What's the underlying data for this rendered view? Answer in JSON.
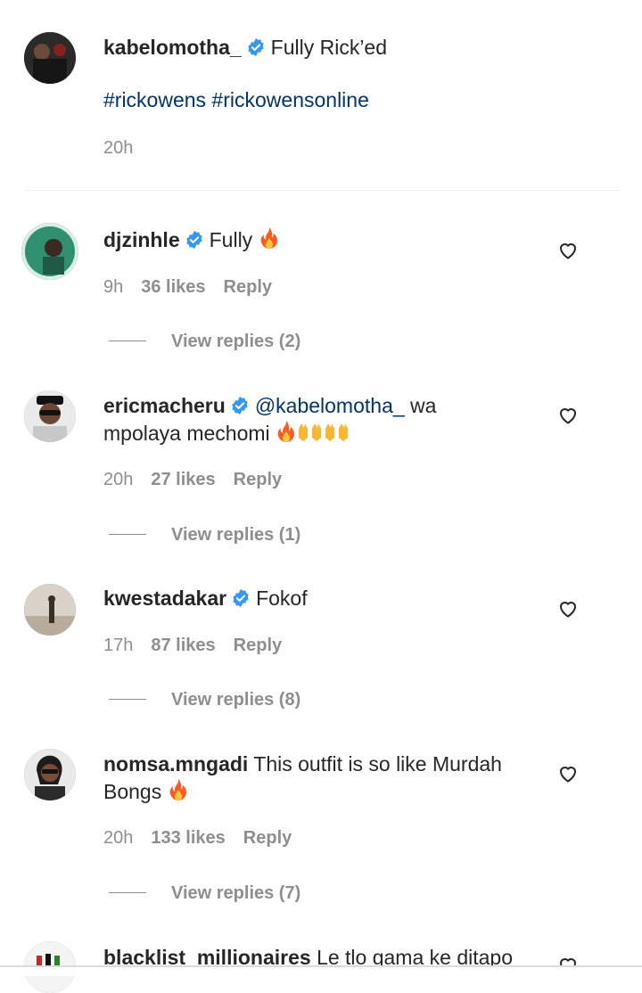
{
  "caption": {
    "username": "kabelomotha_",
    "text": "Fully Rick’ed",
    "hashtags": "#rickowens #rickowensonline",
    "time": "20h"
  },
  "comments": [
    {
      "username": "djzinhle",
      "mention": "",
      "text": "Fully",
      "text2": "",
      "time": "9h",
      "likes": "36 likes",
      "reply": "Reply",
      "view_replies": "View replies (2)"
    },
    {
      "username": "ericmacheru",
      "mention": "@kabelomotha_",
      "text": "wa",
      "text2": "mpolaya mechomi",
      "time": "20h",
      "likes": "27 likes",
      "reply": "Reply",
      "view_replies": "View replies (1)"
    },
    {
      "username": "kwestadakar",
      "mention": "",
      "text": "Fokof",
      "text2": "",
      "time": "17h",
      "likes": "87 likes",
      "reply": "Reply",
      "view_replies": "View replies (8)"
    },
    {
      "username": "nomsa.mngadi",
      "mention": "",
      "text": "This outfit is so like Murdah",
      "text2": "Bongs",
      "time": "20h",
      "likes": "133 likes",
      "reply": "Reply",
      "view_replies": "View replies (7)"
    },
    {
      "username": "blacklist_millionaires",
      "mention": "",
      "text": "Le tlo gama ke ditapo",
      "text2": "",
      "time": "",
      "likes": "",
      "reply": "",
      "view_replies": ""
    }
  ],
  "icons": {
    "verified": "verified-badge-icon",
    "heart": "heart-outline-icon",
    "fire": "fire-emoji",
    "clap": "clapping-hands-emoji"
  },
  "colors": {
    "verified": "#3897f0",
    "link": "#003569",
    "muted": "#8e8e8e",
    "text": "#262626"
  }
}
